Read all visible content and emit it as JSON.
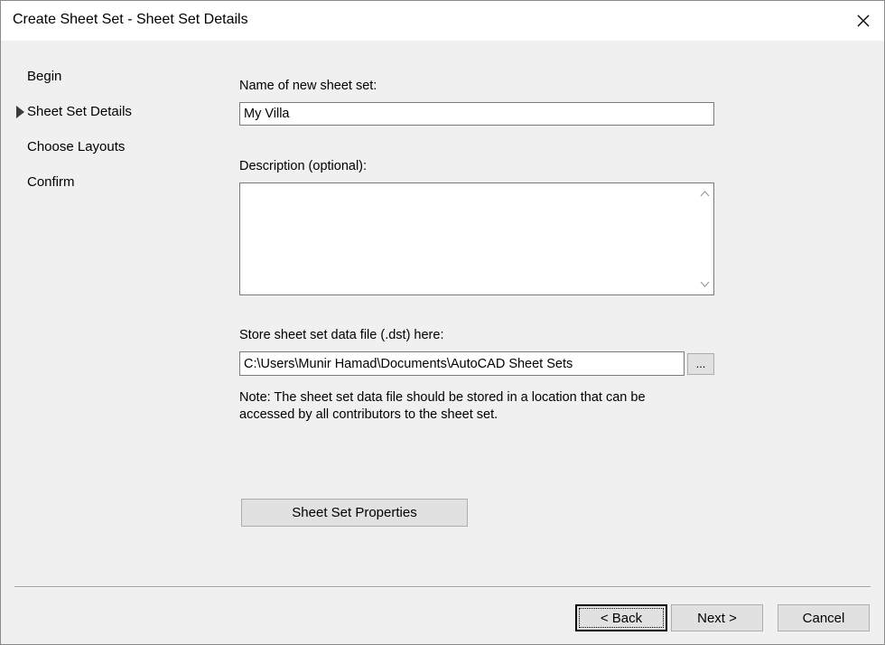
{
  "window": {
    "title": "Create Sheet Set - Sheet Set Details"
  },
  "nav": {
    "items": [
      {
        "label": "Begin",
        "current": false
      },
      {
        "label": "Sheet Set Details",
        "current": true
      },
      {
        "label": "Choose Layouts",
        "current": false
      },
      {
        "label": "Confirm",
        "current": false
      }
    ]
  },
  "form": {
    "name_label": "Name of new sheet set:",
    "name_value": "My Villa",
    "description_label": "Description (optional):",
    "description_value": "",
    "store_label": "Store sheet set data file (.dst) here:",
    "store_path": "C:\\Users\\Munir Hamad\\Documents\\AutoCAD Sheet Sets",
    "browse_label": "...",
    "note": "Note: The sheet set data file should be stored in a location that can be accessed by all contributors to the sheet set.",
    "properties_button": "Sheet Set Properties"
  },
  "footer": {
    "back_label": "< Back",
    "next_label": "Next >",
    "cancel_label": "Cancel"
  },
  "icons": {
    "close": "close-icon",
    "current_step": "triangle-right-icon",
    "scroll_up": "chevron-up-icon",
    "scroll_down": "chevron-down-icon"
  }
}
